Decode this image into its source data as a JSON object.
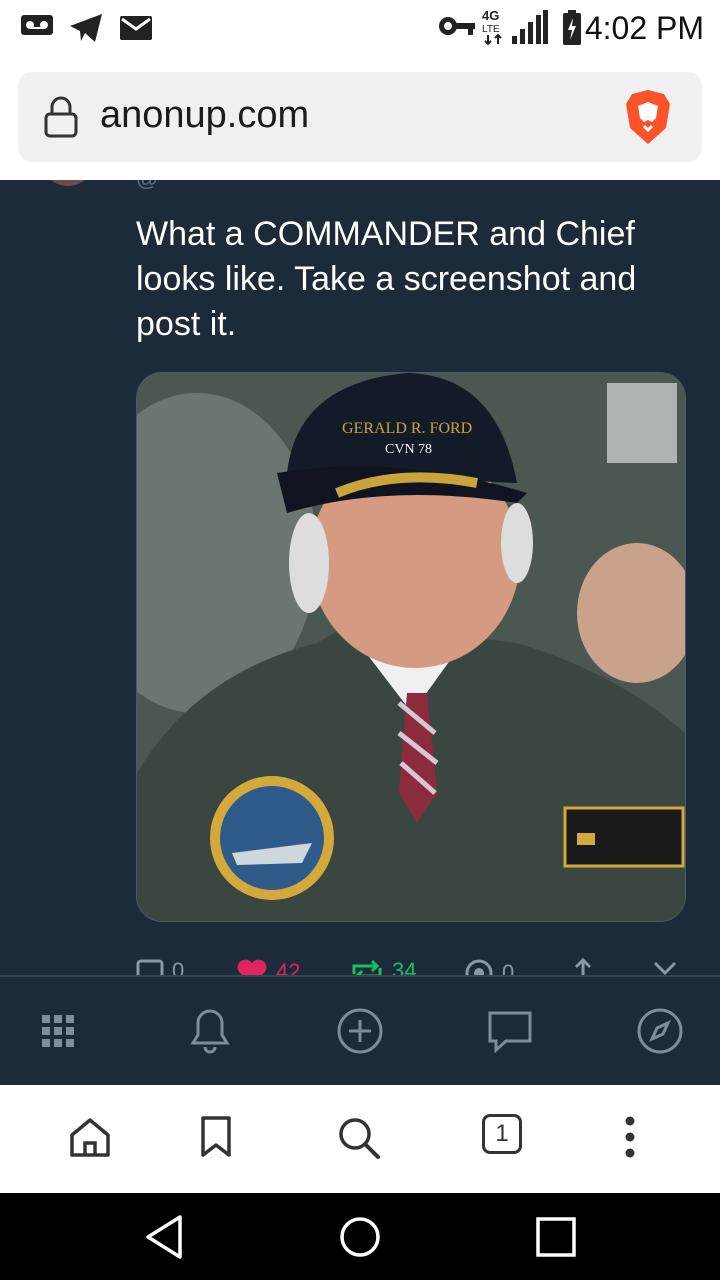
{
  "status_bar": {
    "time": "4:02 PM",
    "icons": [
      "voicemail-icon",
      "telegram-icon",
      "mail-icon",
      "vpn-key-icon",
      "4g-lte-icon",
      "signal-icon",
      "battery-icon"
    ]
  },
  "browser": {
    "url": "anonup.com",
    "tab_count": "1"
  },
  "post": {
    "text": "What a COMMANDER and Chief looks like. Take a screenshot and post it.",
    "image": {
      "cap_text_top": "GERALD R. FORD",
      "cap_text_bottom": "CVN 78"
    },
    "actions": {
      "replies": "0",
      "likes": "42",
      "reposts": "34",
      "views": "0"
    }
  },
  "app_tabs": [
    "apps-grid-icon",
    "bell-icon",
    "add-circle-icon",
    "chat-icon",
    "compass-icon"
  ],
  "browser_bar": [
    "home-icon",
    "bookmark-icon",
    "search-icon",
    "tabs-icon",
    "more-vertical-icon"
  ],
  "android_nav": [
    "back-icon",
    "home-circle-icon",
    "recents-icon"
  ],
  "colors": {
    "background": "#1c2a39",
    "like": "#e0245e",
    "repost": "#17bf63",
    "brave_orange": "#fb542b"
  }
}
